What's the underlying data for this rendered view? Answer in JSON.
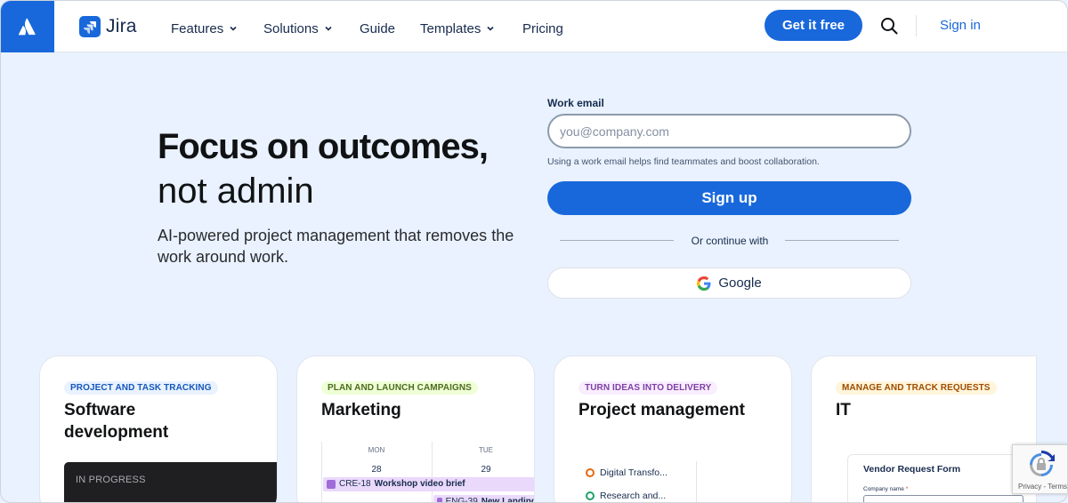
{
  "nav": {
    "brand": "Jira",
    "links": [
      {
        "label": "Features",
        "dropdown": true
      },
      {
        "label": "Solutions",
        "dropdown": true
      },
      {
        "label": "Guide",
        "dropdown": false
      },
      {
        "label": "Templates",
        "dropdown": true
      },
      {
        "label": "Pricing",
        "dropdown": false
      }
    ],
    "cta_label": "Get it free",
    "search_icon": "search-icon",
    "sign_in_label": "Sign in"
  },
  "hero": {
    "title": "Focus on outcomes,",
    "subtitle": "not admin",
    "description": "AI-powered project management that removes the work around work."
  },
  "signup_form": {
    "email_label": "Work email",
    "email_placeholder": "you@company.com",
    "email_value": "",
    "help_text": "Using a work email helps find teammates and boost collaboration.",
    "submit_label": "Sign up",
    "divider_text": "Or continue with",
    "google_label": "Google"
  },
  "cards": [
    {
      "badge": "PROJECT AND TASK TRACKING",
      "title": "Software development",
      "preview": {
        "status": "IN PROGRESS"
      }
    },
    {
      "badge": "PLAN AND LAUNCH CAMPAIGNS",
      "title": "Marketing",
      "preview": {
        "days": [
          "MON",
          "TUE"
        ],
        "dates": [
          "28",
          "29"
        ],
        "events": [
          {
            "key": "CRE-18",
            "text": "Workshop video brief"
          },
          {
            "key": "ENG-39",
            "text": "New Landing"
          }
        ]
      }
    },
    {
      "badge": "TURN IDEAS INTO DELIVERY",
      "title": "Project management",
      "preview": {
        "items": [
          "Digital Transfo...",
          "Research and..."
        ]
      }
    },
    {
      "badge": "MANAGE AND TRACK REQUESTS",
      "title": "IT",
      "preview": {
        "form_title": "Vendor Request Form",
        "field_label": "Company name",
        "field_required": "*"
      }
    }
  ],
  "recaptcha": {
    "privacy": "Privacy",
    "separator": " - ",
    "terms": "Terms"
  },
  "colors": {
    "brand_blue": "#1868db",
    "hero_bg": "#e9f2fe",
    "text_dark": "#101214"
  }
}
